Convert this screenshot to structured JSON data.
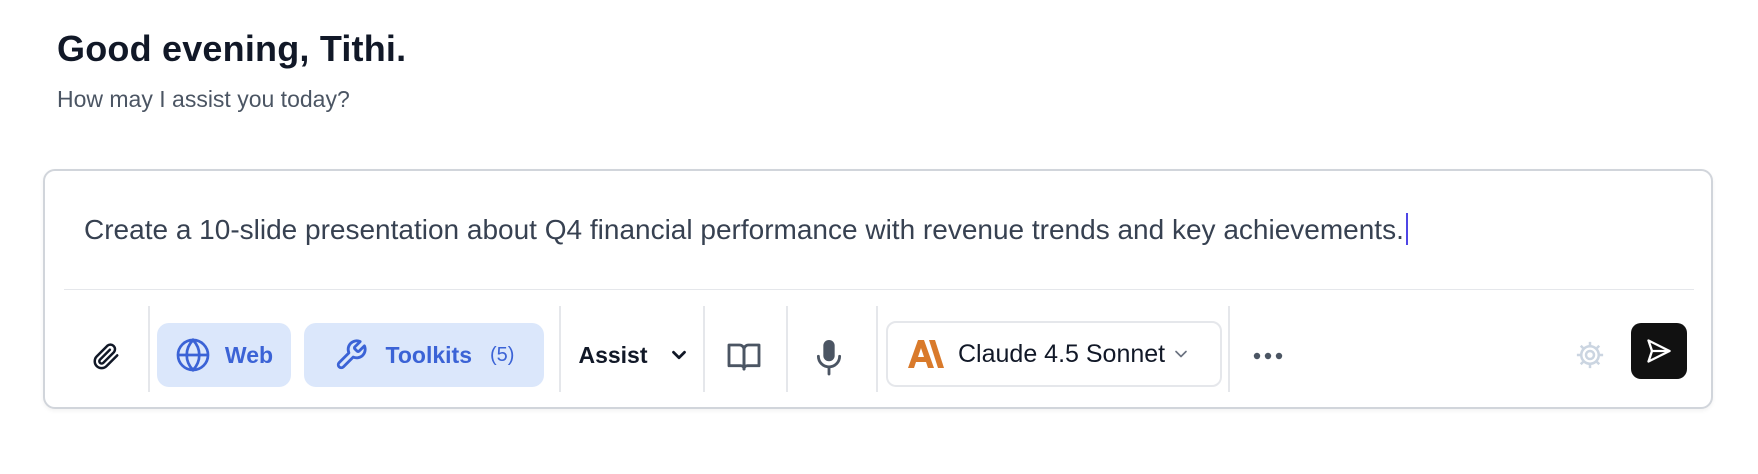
{
  "greeting": {
    "title": "Good evening, Tithi.",
    "subtitle": "How may I assist you today?"
  },
  "composer": {
    "prompt_text": "Create a 10-slide presentation about Q4 financial performance with revenue trends and key achievements.",
    "toolbar": {
      "attach_icon": "paperclip-icon",
      "web_label": "Web",
      "web_icon": "globe-icon",
      "toolkits_label": "Toolkits",
      "toolkits_count": "(5)",
      "toolkits_icon": "wrench-icon",
      "mode_label": "Assist",
      "mode_icon": "chevron-down-icon",
      "library_icon": "book-icon",
      "mic_icon": "microphone-icon",
      "model_label": "Claude 4.5 Sonnet",
      "model_icon": "anthropic-logo-icon",
      "more_icon": "more-dots-icon",
      "settings_icon": "gear-icon",
      "send_icon": "send-icon"
    },
    "colors": {
      "accent": "#3b63d6",
      "pill_background": "#dbe7fb",
      "anthropic_logo": "#d97a2b",
      "send_background": "#111111"
    }
  }
}
